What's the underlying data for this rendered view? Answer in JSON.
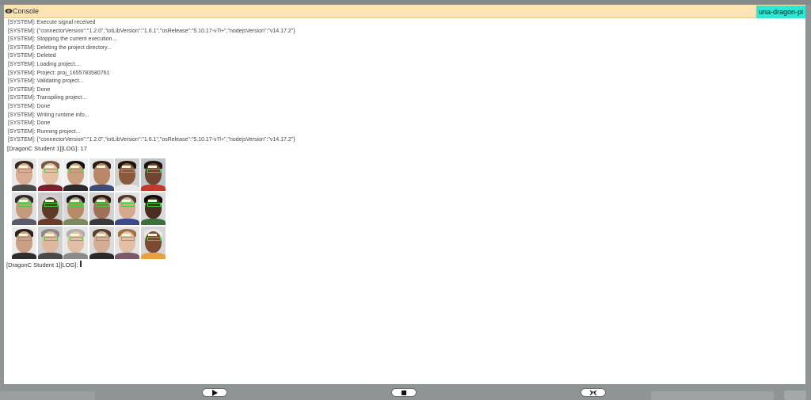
{
  "console": {
    "title": "Console",
    "badge": "una-dragon-pi"
  },
  "log": {
    "lines": [
      "[SYSTEM]: Execute signal received",
      "[SYSTEM]: {\"connectorVersion\":\"1.2.0\",\"iotLibVersion\":\"1.6.1\",\"osRelease\":\"5.10.17-v7l+\",\"nodejsVersion\":\"v14.17.2\"}",
      "[SYSTEM]: Stopping the current execution...",
      "[SYSTEM]: Deleting the project directory...",
      "[SYSTEM]: Deleted",
      "[SYSTEM]: Loading project...",
      "[SYSTEM]: Project: proj_1655783580761",
      "[SYSTEM]: Validating project...",
      "[SYSTEM]: Done",
      "[SYSTEM]: Transpiling project...",
      "[SYSTEM]: Done",
      "[SYSTEM]: Writing runtime info...",
      "[SYSTEM]: Done",
      "[SYSTEM]: Running project...",
      "[SYSTEM]: {\"connectorVersion\":\"1.2.0\",\"iotLibVersion\":\"1.6.1\",\"osRelease\":\"5.10.17-v7l+\",\"nodejsVersion\":\"v14.17.2\"}"
    ],
    "student_log_1": "[DragonC Student 1][LOG]: 17",
    "student_log_2": "[DragonC Student 1][LOG]:"
  },
  "faces": [
    {
      "skin": "#d9ad94",
      "hair": "#3a2a22",
      "shirt": "#4a4a4a",
      "bg": "#e8e8e8"
    },
    {
      "skin": "#e3c0a6",
      "hair": "#7a5a40",
      "shirt": "#7d1f2a",
      "bg": "#efefef"
    },
    {
      "skin": "#caa080",
      "hair": "#111111",
      "shirt": "#2b2b2b",
      "bg": "#f0f0f0"
    },
    {
      "skin": "#b88668",
      "hair": "#2a1e18",
      "shirt": "#3c4d7a",
      "bg": "#e6e6e6"
    },
    {
      "skin": "#8a5a3e",
      "hair": "#1c140f",
      "shirt": "#e8e8e8",
      "bg": "#cfcfcf"
    },
    {
      "skin": "#6d4530",
      "hair": "#1a1410",
      "shirt": "#c23a2a",
      "bg": "#bfc4c8"
    },
    {
      "skin": "#c69a7d",
      "hair": "#2a2a2a",
      "shirt": "#5a5a6a",
      "bg": "#e0e0e0"
    },
    {
      "skin": "#5e3a28",
      "hair": "#cfcfcf",
      "shirt": "#6a3a2a",
      "bg": "#c8c8c8"
    },
    {
      "skin": "#b78a6a",
      "hair": "#1a1a1a",
      "shirt": "#7a8a5a",
      "bg": "#d8d8d8"
    },
    {
      "skin": "#a0705a",
      "hair": "#2a1a12",
      "shirt": "#3a3a3a",
      "bg": "#d2d2d2"
    },
    {
      "skin": "#d6a890",
      "hair": "#4a3a30",
      "shirt": "#3a4a8a",
      "bg": "#e2e2e2"
    },
    {
      "skin": "#4a2e22",
      "hair": "#0f0b08",
      "shirt": "#3b6f3b",
      "bg": "#d9d9d9"
    },
    {
      "skin": "#c9a085",
      "hair": "#2a211a",
      "shirt": "#2e2e2e",
      "bg": "#ececec"
    },
    {
      "skin": "#dbb89e",
      "hair": "#8a8a8a",
      "shirt": "#4a4a4a",
      "bg": "#d0d0d0"
    },
    {
      "skin": "#e0bfa6",
      "hair": "#b0b0b0",
      "shirt": "#8a8a8a",
      "bg": "#e8e8e8"
    },
    {
      "skin": "#d4ad95",
      "hair": "#5a4030",
      "shirt": "#2a2a2a",
      "bg": "#dcdcdc"
    },
    {
      "skin": "#e2c0a6",
      "hair": "#a07040",
      "shirt": "#7a5a6a",
      "bg": "#e4e4e4"
    },
    {
      "skin": "#7a4a32",
      "hair": "#e8e8e8",
      "shirt": "#e8a040",
      "bg": "#d6d6d6"
    }
  ],
  "controls": {
    "play": "play-icon",
    "stop": "stop-icon",
    "fullscreen": "collapse-icon"
  }
}
